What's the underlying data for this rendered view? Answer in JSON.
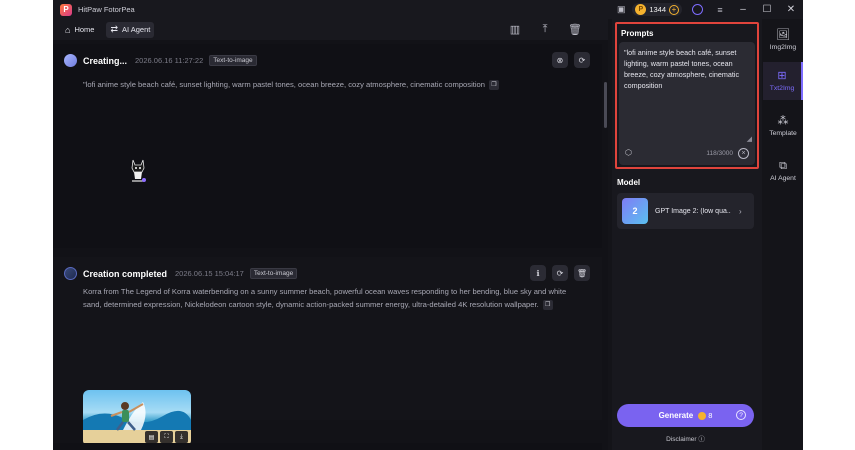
{
  "app": {
    "title": "HitPaw FotorPea",
    "logo_letter": "P",
    "credits": "1344",
    "window_controls": [
      "minimize",
      "maximize",
      "close"
    ]
  },
  "nav": {
    "home_label": "Home",
    "agent_label": "AI Agent"
  },
  "cards": [
    {
      "title": "Creating...",
      "time": "2026.06.16  11:27:22",
      "tag": "Text-to-image",
      "prompt": "\"lofi anime style beach café, sunset lighting, warm pastel tones, ocean breeze, cozy atmosphere, cinematic composition"
    },
    {
      "title": "Creation completed",
      "time": "2026.06.15  15:04:17",
      "tag": "Text-to-image",
      "prompt": "Korra from The Legend of Korra waterbending on a sunny summer beach, powerful ocean waves responding to her bending, blue sky and white sand, determined expression, Nickelodeon cartoon style, dynamic action-packed summer energy, ultra-detailed 4K resolution wallpaper."
    }
  ],
  "panel": {
    "prompts_title": "Prompts",
    "prompt_text": "\"lofi anime style beach café, sunset lighting, warm pastel tones, ocean breeze, cozy atmosphere, cinematic composition",
    "char_count": "118/3000",
    "model_title": "Model",
    "model_name": "GPT Image 2: (low qua...",
    "model_thumb_text": "2",
    "generate_label": "Generate",
    "generate_cost": "8",
    "disclaimer": "Disclaimer"
  },
  "tools": [
    {
      "label": "Img2Img",
      "icon": "image-plus-icon"
    },
    {
      "label": "Txt2Img",
      "icon": "text-image-icon",
      "active": true
    },
    {
      "label": "Template",
      "icon": "grid-icon"
    },
    {
      "label": "AI Agent",
      "icon": "chat-bot-icon"
    }
  ],
  "colors": {
    "accent": "#7a63f0",
    "highlight_border": "#e0443c",
    "background": "#141419",
    "coin": "#f5b22e"
  }
}
